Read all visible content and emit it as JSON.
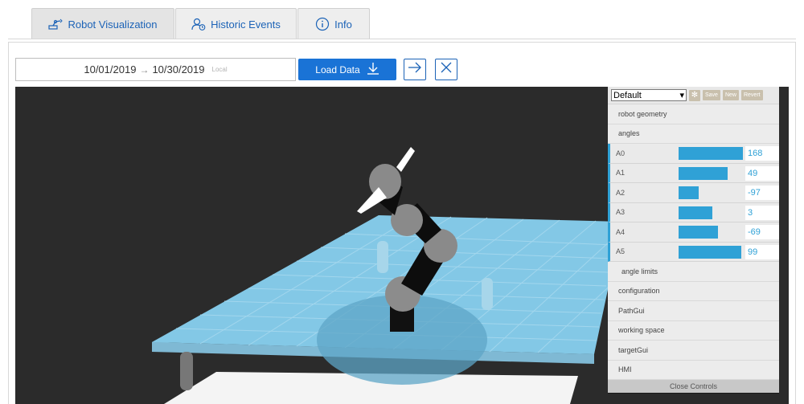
{
  "tabs": [
    {
      "label": "Robot Visualization",
      "icon": "robot-arm-icon",
      "active": true
    },
    {
      "label": "Historic Events",
      "icon": "user-history-icon",
      "active": false
    },
    {
      "label": "Info",
      "icon": "info-icon",
      "active": false
    }
  ],
  "date_range": {
    "start": "10/01/2019",
    "end": "10/30/2019",
    "timezone": "Local"
  },
  "load_button": {
    "label": "Load Data",
    "icon": "download-icon"
  },
  "accent_color": "#1a73d6",
  "controls": {
    "preset": "Default",
    "save_label": "Save",
    "new_label": "New",
    "revert_label": "Revert",
    "folders_top": [
      "robot geometry",
      "angles"
    ],
    "angles": [
      {
        "label": "A0",
        "value": "168",
        "fill": 1.0
      },
      {
        "label": "A1",
        "value": "49",
        "fill": 0.76
      },
      {
        "label": "A2",
        "value": "-97",
        "fill": 0.31
      },
      {
        "label": "A3",
        "value": "3",
        "fill": 0.52
      },
      {
        "label": "A4",
        "value": "-69",
        "fill": 0.61
      },
      {
        "label": "A5",
        "value": "99",
        "fill": 0.98
      }
    ],
    "angle_limits": "angle limits",
    "folders_bottom": [
      "configuration",
      "PathGui",
      "working space",
      "targetGui",
      "HMI"
    ],
    "close_label": "Close Controls",
    "slider_color": "#2fa1d6"
  }
}
